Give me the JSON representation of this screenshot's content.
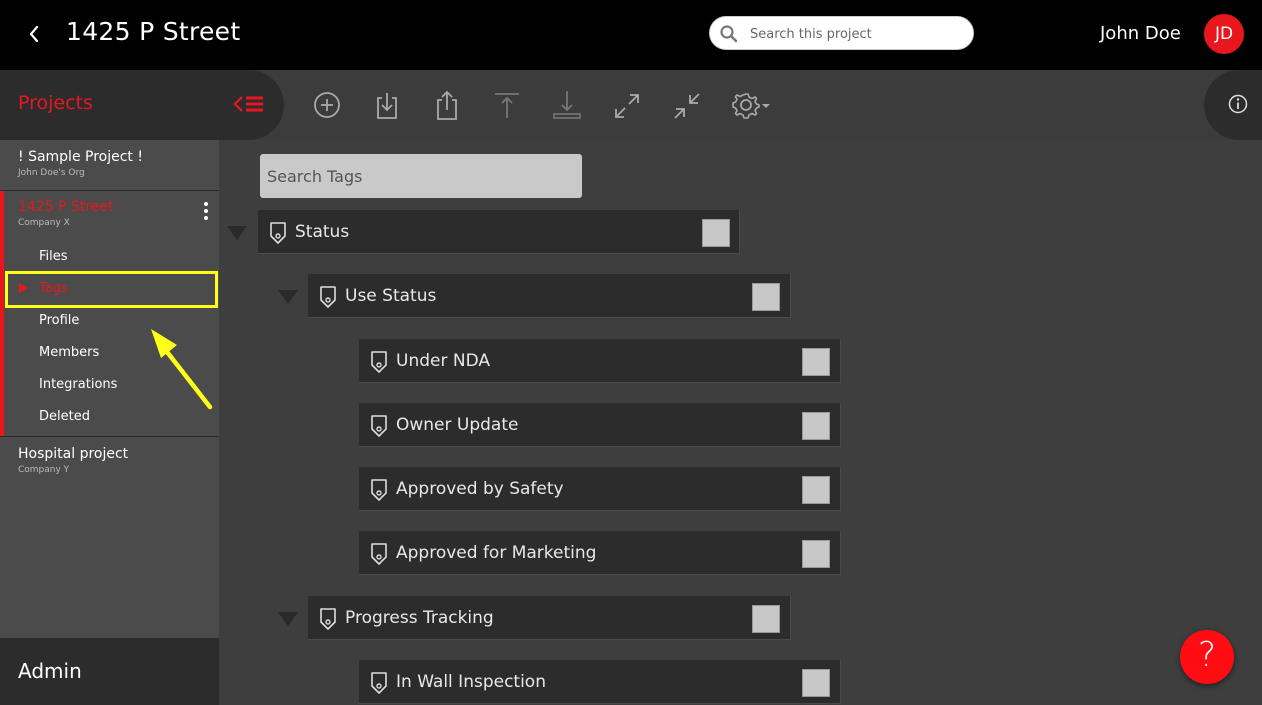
{
  "header": {
    "title": "1425 P Street",
    "search_placeholder": "Search this project",
    "user_name": "John Doe",
    "user_initials": "JD"
  },
  "sidebar": {
    "title": "Projects",
    "projects": [
      {
        "name": "! Sample Project !",
        "org": "John Doe's Org"
      },
      {
        "name": "1425 P Street",
        "org": "Company X"
      },
      {
        "name": "Hospital project",
        "org": "Company Y"
      }
    ],
    "subitems": [
      "Files",
      "Tags",
      "Profile",
      "Members",
      "Integrations",
      "Deleted"
    ],
    "active_subitem": "Tags",
    "admin_label": "Admin"
  },
  "toolbar": {
    "icons": [
      "add-icon",
      "download-icon",
      "share-icon",
      "upload-icon",
      "download-tray-icon",
      "expand-icon",
      "collapse-icon",
      "settings-icon"
    ]
  },
  "tags": {
    "search_placeholder": "Search Tags",
    "items": [
      {
        "label": "Status",
        "level": 0,
        "expandable": true
      },
      {
        "label": "Use Status",
        "level": 1,
        "expandable": true
      },
      {
        "label": "Under NDA",
        "level": 2,
        "expandable": false
      },
      {
        "label": "Owner Update",
        "level": 2,
        "expandable": false
      },
      {
        "label": "Approved by Safety",
        "level": 2,
        "expandable": false
      },
      {
        "label": "Approved for Marketing",
        "level": 2,
        "expandable": false
      },
      {
        "label": "Progress Tracking",
        "level": 1,
        "expandable": true
      },
      {
        "label": "In Wall Inspection",
        "level": 2,
        "expandable": false
      }
    ]
  },
  "help": {
    "label": "?"
  },
  "colors": {
    "accent": "#e8171e",
    "highlight": "#ffff1a"
  }
}
